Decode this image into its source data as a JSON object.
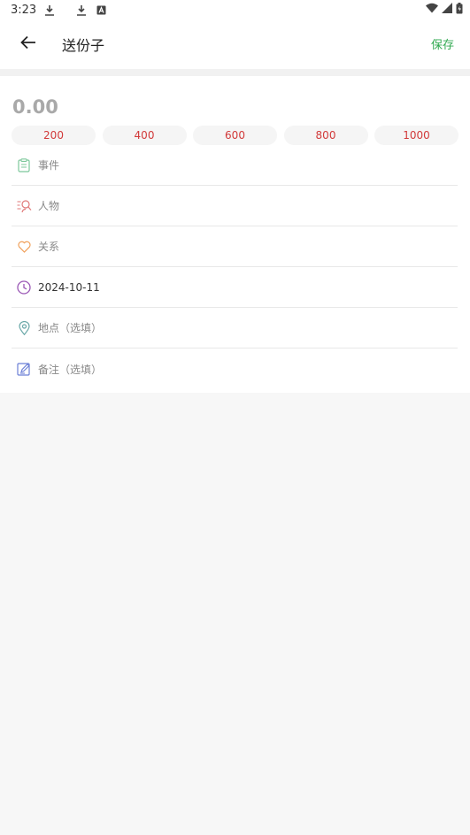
{
  "status_bar": {
    "time": "3:23",
    "icons": [
      "download-icon",
      "download-icon",
      "font-icon",
      "wifi-icon",
      "signal-icon",
      "battery-icon"
    ]
  },
  "header": {
    "title": "送份子",
    "save_label": "保存"
  },
  "amount": {
    "value": "0.00"
  },
  "quick_amounts": [
    "200",
    "400",
    "600",
    "800",
    "1000"
  ],
  "fields": {
    "event": {
      "label": "事件",
      "icon": "clipboard-icon"
    },
    "person": {
      "label": "人物",
      "icon": "person-search-icon"
    },
    "relation": {
      "label": "关系",
      "icon": "heart-icon"
    },
    "date": {
      "value": "2024-10-11",
      "icon": "clock-icon"
    },
    "location": {
      "label": "地点（选填）",
      "icon": "location-pin-icon"
    },
    "note": {
      "label": "备注（选填）",
      "icon": "edit-note-icon"
    }
  },
  "colors": {
    "accent_green": "#2fa84f",
    "chip_text": "#d23a3a",
    "background": "#f7f7f7"
  }
}
